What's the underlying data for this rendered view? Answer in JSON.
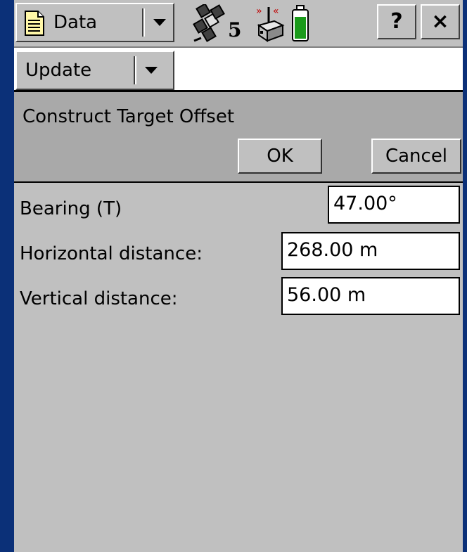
{
  "topbar": {
    "data_menu_label": "Data",
    "satellite_count": "5",
    "help_label": "?",
    "close_label": "×",
    "battery_color": "#1a9a1a"
  },
  "secondbar": {
    "update_menu_label": "Update"
  },
  "dialog": {
    "title": "Construct Target Offset",
    "ok_label": "OK",
    "cancel_label": "Cancel"
  },
  "form": {
    "bearing_label": "Bearing (T)",
    "bearing_value": "47.00°",
    "horizontal_label": "Horizontal distance:",
    "horizontal_value": "268.00 m",
    "vertical_label": "Vertical distance:",
    "vertical_value": "56.00 m"
  }
}
